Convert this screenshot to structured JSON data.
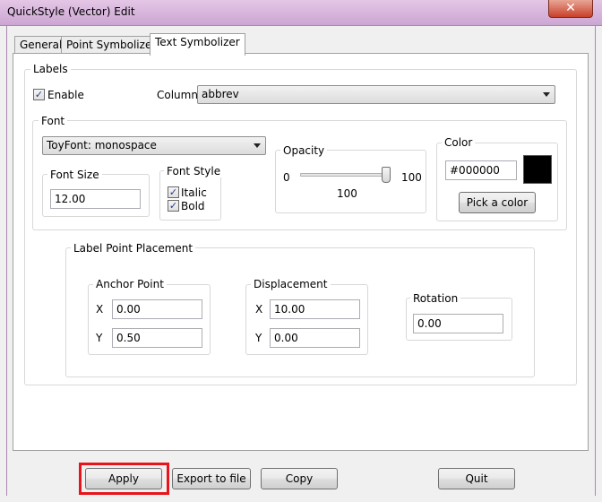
{
  "window": {
    "title": "QuickStyle (Vector) Edit",
    "close_glyph": "✕"
  },
  "tabs": [
    {
      "label": "General"
    },
    {
      "label": "Point Symbolizer"
    },
    {
      "label": "Text Symbolizer"
    }
  ],
  "labels_group": {
    "title": "Labels",
    "enable_label": "Enable",
    "enable_checked": true,
    "column_label": "Column:",
    "column_value": "abbrev"
  },
  "font_group": {
    "title": "Font",
    "font_value": "ToyFont: monospace",
    "font_size": {
      "title": "Font Size",
      "value": "12.00"
    },
    "font_style": {
      "title": "Font Style",
      "italic_label": "Italic",
      "bold_label": "Bold",
      "italic_checked": true,
      "bold_checked": true
    },
    "opacity": {
      "title": "Opacity",
      "min": "0",
      "max": "100",
      "value": "100"
    },
    "color": {
      "title": "Color",
      "value": "#000000",
      "swatch": "#000000",
      "pick_label": "Pick a color"
    }
  },
  "placement_group": {
    "title": "Label Point Placement",
    "anchor": {
      "title": "Anchor Point",
      "x_label": "X",
      "y_label": "Y",
      "x": "0.00",
      "y": "0.50"
    },
    "displacement": {
      "title": "Displacement",
      "x_label": "X",
      "y_label": "Y",
      "x": "10.00",
      "y": "0.00"
    },
    "rotation": {
      "title": "Rotation",
      "value": "0.00"
    }
  },
  "buttons": {
    "apply": "Apply",
    "export": "Export to file",
    "copy": "Copy",
    "quit": "Quit"
  },
  "colors": {
    "highlight": "#e8141b",
    "titlebar": "#cba6d2"
  }
}
